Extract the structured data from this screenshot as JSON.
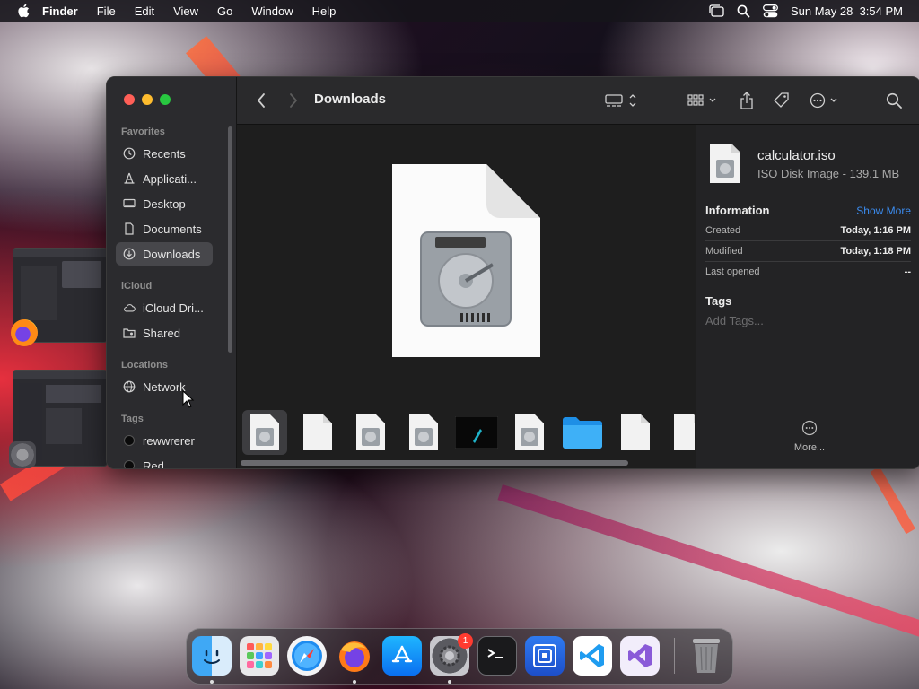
{
  "menubar": {
    "app": "Finder",
    "items": [
      "File",
      "Edit",
      "View",
      "Go",
      "Window",
      "Help"
    ],
    "clock": "Sun May 28  3:54 PM"
  },
  "finder": {
    "title": "Downloads",
    "sidebar": {
      "favorites_header": "Favorites",
      "favorites": [
        {
          "label": "Recents",
          "icon": "clock-icon"
        },
        {
          "label": "Applicati...",
          "icon": "applications-icon"
        },
        {
          "label": "Desktop",
          "icon": "desktop-icon"
        },
        {
          "label": "Documents",
          "icon": "document-icon"
        },
        {
          "label": "Downloads",
          "icon": "download-icon",
          "selected": true
        }
      ],
      "icloud_header": "iCloud",
      "icloud": [
        {
          "label": "iCloud Dri...",
          "icon": "cloud-icon"
        },
        {
          "label": "Shared",
          "icon": "shared-folder-icon"
        }
      ],
      "locations_header": "Locations",
      "locations": [
        {
          "label": "Network",
          "icon": "globe-icon"
        }
      ],
      "tags_header": "Tags",
      "tags": [
        {
          "label": "rewwrerer",
          "color": "#000000"
        },
        {
          "label": "Red",
          "color": "#000000"
        }
      ]
    },
    "info": {
      "file_name": "calculator.iso",
      "file_kind": "ISO Disk Image - 139.1 MB",
      "information_header": "Information",
      "show_more": "Show More",
      "rows": [
        {
          "key": "Created",
          "value": "Today, 1:16 PM"
        },
        {
          "key": "Modified",
          "value": "Today, 1:18 PM"
        },
        {
          "key": "Last opened",
          "value": "--"
        }
      ],
      "tags_header": "Tags",
      "add_tags_placeholder": "Add Tags...",
      "more_label": "More..."
    }
  },
  "dock": {
    "items": [
      "finder-icon",
      "launchpad-icon",
      "safari-icon",
      "firefox-icon",
      "app-store-icon",
      "system-settings-icon",
      "terminal-icon",
      "virtual-machine-icon",
      "vscode-icon",
      "visual-studio-icon",
      "trash-icon"
    ],
    "settings_badge": "1"
  },
  "colors": {
    "accent": "#3b8cf0",
    "close": "#ff5f57",
    "minimize": "#febc2e",
    "zoom": "#28c840"
  }
}
